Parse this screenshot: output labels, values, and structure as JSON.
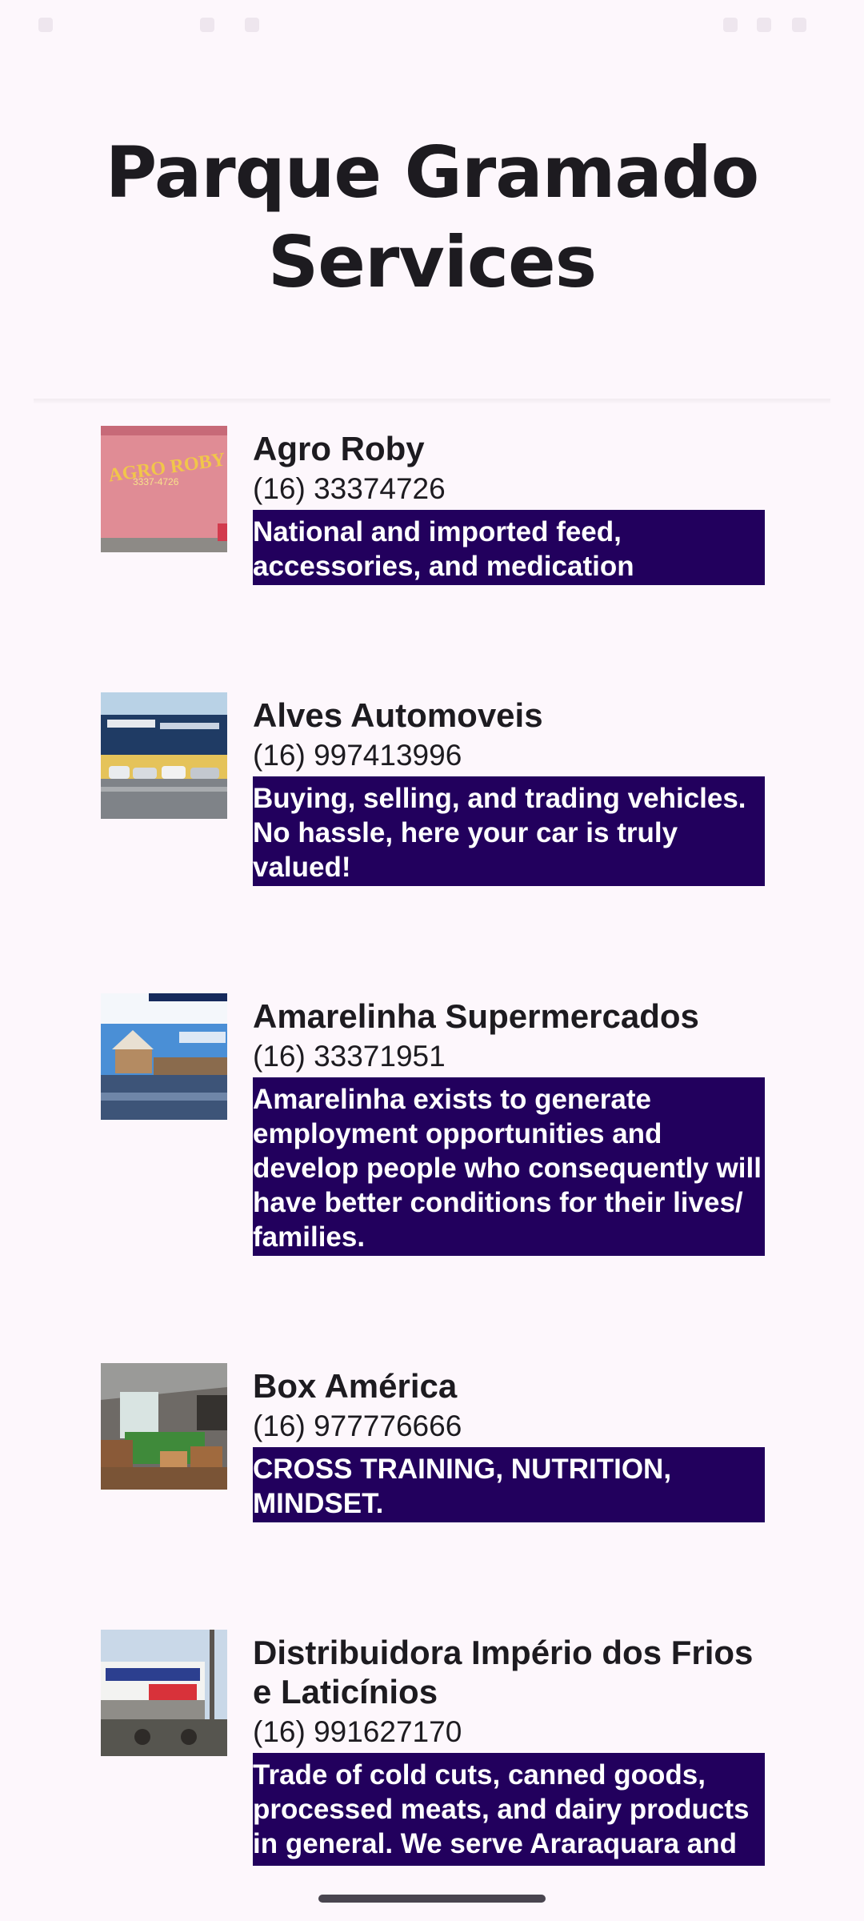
{
  "page": {
    "title": "Parque Gramado Services"
  },
  "colors": {
    "background": "#fdf7fc",
    "description_background": "#22005d",
    "description_text": "#ffffff",
    "text": "#1d1b20"
  },
  "services": [
    {
      "name": "Agro Roby",
      "phone": "(16) 33374726",
      "description": "National and imported feed, accessories, and medication",
      "image_icon": "storefront-photo-icon",
      "image_sign_text": "AGRO ROBY",
      "image_sign_phone": "3337-4726"
    },
    {
      "name": "Alves Automoveis",
      "phone": "(16) 997413996",
      "description": "Buying, selling, and trading vehicles. No hassle, here your car is truly valued!",
      "image_icon": "car-dealership-photo-icon"
    },
    {
      "name": "Amarelinha Supermercados",
      "phone": "(16) 33371951",
      "description": "Amarelinha exists to generate employment opportunities and develop people who consequently will have better conditions for their lives/ families.",
      "image_icon": "supermarket-photo-icon"
    },
    {
      "name": "Box América",
      "phone": "(16) 977776666",
      "description": "CROSS TRAINING, NUTRITION, MINDSET.",
      "image_icon": "gym-photo-icon"
    },
    {
      "name": "Distribuidora Império dos Frios e Laticínios",
      "phone": "(16) 991627170",
      "description": "Trade of cold cuts, canned goods, processed meats, and dairy products in general. We serve Araraquara and Região!",
      "image_icon": "distributor-storefront-photo-icon"
    }
  ]
}
